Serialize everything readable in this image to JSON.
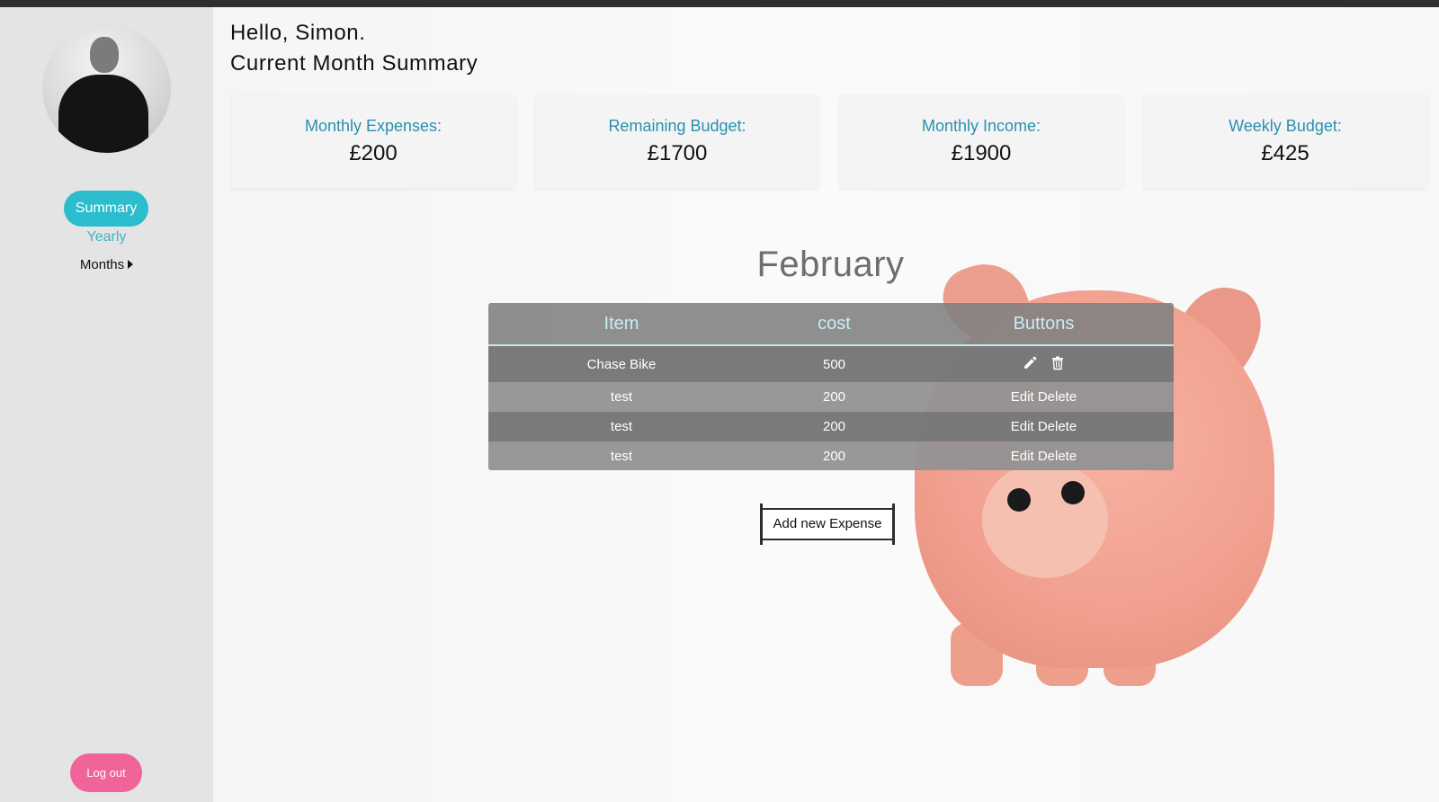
{
  "greeting": {
    "hello": "Hello, Simon.",
    "subtitle": "Current Month Summary"
  },
  "sidebar": {
    "nav": {
      "summary": "Summary",
      "yearly": "Yearly",
      "months": "Months"
    },
    "logout": "Log out"
  },
  "cards": [
    {
      "label": "Monthly Expenses:",
      "value": "£200"
    },
    {
      "label": "Remaining Budget:",
      "value": "£1700"
    },
    {
      "label": "Monthly Income:",
      "value": "£1900"
    },
    {
      "label": "Weekly Budget:",
      "value": "£425"
    }
  ],
  "month": "February",
  "table": {
    "headers": [
      "Item",
      "cost",
      "Buttons"
    ],
    "rows": [
      {
        "item": "Chase Bike",
        "cost": "500",
        "actions": [
          "pencil-icon",
          "trash-icon"
        ]
      },
      {
        "item": "test",
        "cost": "200",
        "edit": "Edit",
        "delete": "Delete"
      },
      {
        "item": "test",
        "cost": "200",
        "edit": "Edit",
        "delete": "Delete"
      },
      {
        "item": "test",
        "cost": "200",
        "edit": "Edit",
        "delete": "Delete"
      }
    ]
  },
  "add_button": "Add new Expense",
  "colors": {
    "accent": "#2bbccd",
    "logout": "#f0649a",
    "card_label": "#2a8fb0"
  }
}
